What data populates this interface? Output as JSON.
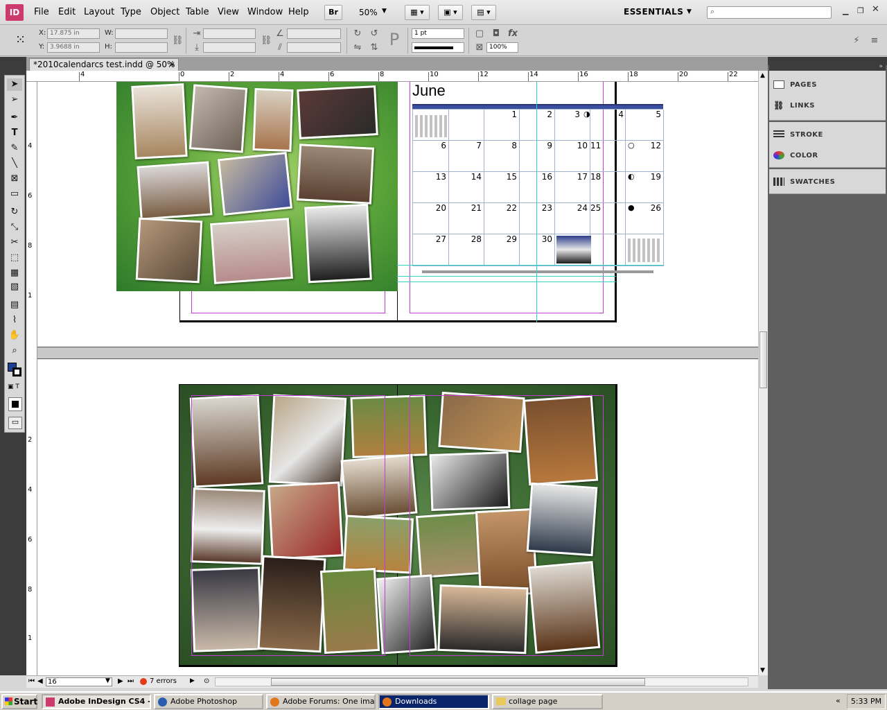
{
  "app": {
    "logo": "ID",
    "workspace": "ESSENTIALS"
  },
  "menu": [
    "File",
    "Edit",
    "Layout",
    "Type",
    "Object",
    "Table",
    "View",
    "Window",
    "Help"
  ],
  "toolbar": {
    "bridge": "Br",
    "zoom": "50%"
  },
  "control_panel": {
    "x_label": "X:",
    "x_value": "17.875 in",
    "y_label": "Y:",
    "y_value": "3.9688 in",
    "w_label": "W:",
    "h_label": "H:",
    "stroke_weight": "1 pt",
    "opacity": "100%"
  },
  "document": {
    "tab_title": "*2010calendarcs test.indd @ 50%",
    "close": "×"
  },
  "ruler_h": [
    "4",
    "0",
    "2",
    "4",
    "6",
    "8",
    "10",
    "12",
    "14",
    "16",
    "18",
    "20",
    "22"
  ],
  "ruler_v": [
    "4",
    "6",
    "8",
    "1",
    "2",
    "4",
    "6",
    "8",
    "1"
  ],
  "calendar": {
    "month": "June",
    "rows": [
      [
        "",
        "",
        "1",
        "2",
        "3",
        "4",
        "5"
      ],
      [
        "6",
        "7",
        "8",
        "9",
        "10",
        "11",
        "12"
      ],
      [
        "13",
        "14",
        "15",
        "16",
        "17",
        "18",
        "19"
      ],
      [
        "20",
        "21",
        "22",
        "23",
        "24",
        "25",
        "26"
      ],
      [
        "27",
        "28",
        "29",
        "30",
        "",
        "",
        ""
      ]
    ],
    "moon_icons": [
      {
        "row": 0,
        "col": 4,
        "icon": "◑"
      },
      {
        "row": 1,
        "col": 5,
        "icon": "○"
      },
      {
        "row": 2,
        "col": 5,
        "icon": "◐"
      },
      {
        "row": 3,
        "col": 5,
        "icon": "●"
      }
    ]
  },
  "status": {
    "page": "16",
    "errors": "7 errors"
  },
  "panels": [
    "PAGES",
    "LINKS",
    "STROKE",
    "COLOR",
    "SWATCHES"
  ],
  "taskbar": {
    "start": "Start",
    "tasks": [
      "Adobe InDesign CS4 -...",
      "Adobe Photoshop",
      "Adobe Forums: One ima...",
      "Downloads",
      "collage page"
    ],
    "clock": "5:33 PM"
  },
  "colors": {
    "accent": "#c13bd4",
    "guide": "#2fd0d0",
    "calendar_bar": "#3b4fa0"
  }
}
